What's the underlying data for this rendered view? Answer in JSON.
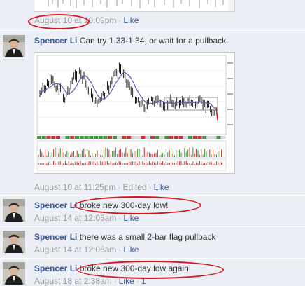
{
  "top": {
    "timestamp": "August 10 at 10:09pm",
    "like_label": "Like"
  },
  "comments": [
    {
      "author": "Spencer Li",
      "text": "Can try 1.33-1.34, or wait for a pullback.",
      "timestamp": "August 10 at 11:25pm",
      "edited_label": "Edited",
      "like_label": "Like"
    },
    {
      "author": "Spencer Li",
      "text": "broke new 300-day low!",
      "timestamp": "August 14 at 12:05am",
      "like_label": "Like"
    },
    {
      "author": "Spencer Li",
      "text": "there was a small 2-bar flag pullback",
      "timestamp": "August 14 at 12:06am",
      "like_label": "Like"
    },
    {
      "author": "Spencer Li",
      "text": "broke new 300-day low again!",
      "timestamp": "August 18 at 2:38am",
      "like_label": "Like",
      "like_count": "1"
    }
  ],
  "colors": {
    "link": "#3b5998",
    "annotation": "#d9141a",
    "meta": "#999999",
    "background": "#eceff5"
  }
}
